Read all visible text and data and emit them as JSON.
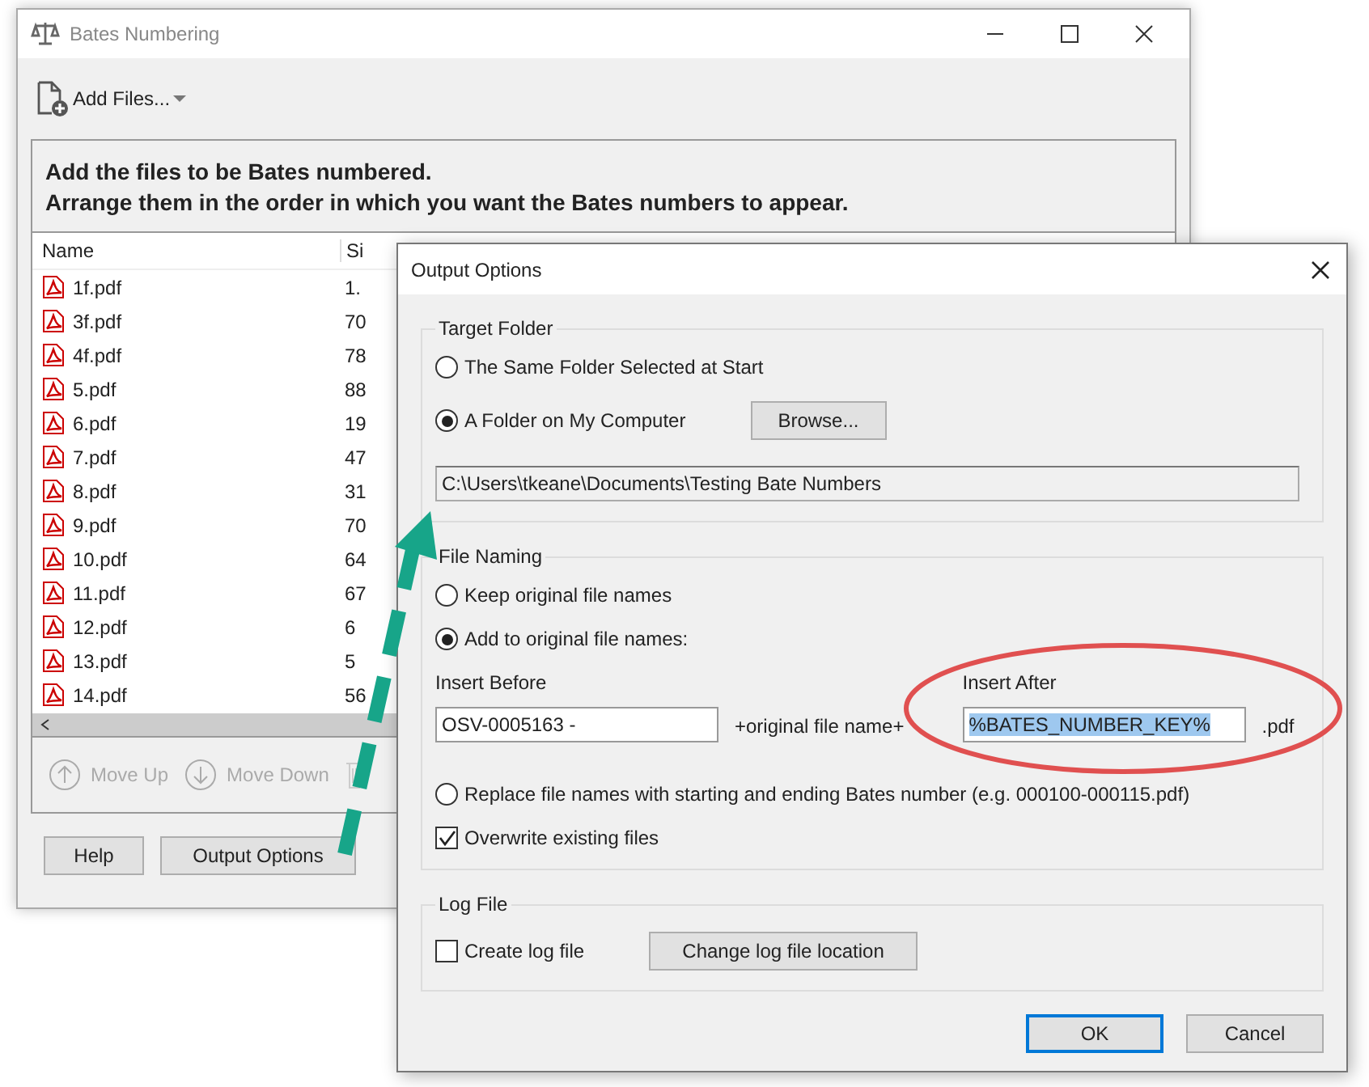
{
  "main_window": {
    "title": "Bates Numbering",
    "add_files": "Add Files...",
    "instructions": [
      "Add the files to be Bates numbered.",
      "Arrange them in the order in which you want the Bates numbers to appear."
    ],
    "columns": [
      "Name",
      "Si"
    ],
    "files": [
      {
        "name": "1f.pdf",
        "size": "1."
      },
      {
        "name": "3f.pdf",
        "size": "70"
      },
      {
        "name": "4f.pdf",
        "size": "78"
      },
      {
        "name": "5.pdf",
        "size": "88"
      },
      {
        "name": "6.pdf",
        "size": "19"
      },
      {
        "name": "7.pdf",
        "size": "47"
      },
      {
        "name": "8.pdf",
        "size": "31"
      },
      {
        "name": "9.pdf",
        "size": "70"
      },
      {
        "name": "10.pdf",
        "size": "64"
      },
      {
        "name": "11.pdf",
        "size": "67"
      },
      {
        "name": "12.pdf",
        "size": "6"
      },
      {
        "name": "13.pdf",
        "size": "5"
      },
      {
        "name": "14.pdf",
        "size": "56"
      }
    ],
    "actions": [
      {
        "label": "Move Up",
        "kind": "up",
        "disabled": true
      },
      {
        "label": "Move Down",
        "kind": "down",
        "disabled": true
      }
    ],
    "buttons": [
      "Help",
      "Output Options"
    ]
  },
  "dialog": {
    "title": "Output Options",
    "target_folder": {
      "legend": "Target Folder",
      "options": [
        {
          "label": "The Same Folder Selected at Start",
          "selected": false
        },
        {
          "label": "A Folder on My Computer",
          "selected": true
        }
      ],
      "browse": "Browse...",
      "path": "C:\\Users\\tkeane\\Documents\\Testing Bate Numbers"
    },
    "file_naming": {
      "legend": "File Naming",
      "keep": {
        "label": "Keep original file names",
        "selected": false
      },
      "add": {
        "label": "Add to original file names:",
        "selected": true
      },
      "insert_before": {
        "label": "Insert Before",
        "value": "OSV-0005163 -"
      },
      "joiner": "+original file name+",
      "insert_after": {
        "label": "Insert After",
        "value": "%BATES_NUMBER_KEY%",
        "highlighted": true
      },
      "extension": ".pdf",
      "replace": {
        "label": "Replace file names with starting and ending Bates number (e.g. 000100-000115.pdf)",
        "selected": false
      },
      "overwrite": {
        "label": "Overwrite existing files",
        "checked": true
      }
    },
    "log_file": {
      "legend": "Log File",
      "create": {
        "label": "Create log file",
        "checked": false
      },
      "change": "Change log file location"
    },
    "buttons": [
      {
        "label": "OK",
        "default": true
      },
      {
        "label": "Cancel",
        "default": false
      }
    ]
  }
}
